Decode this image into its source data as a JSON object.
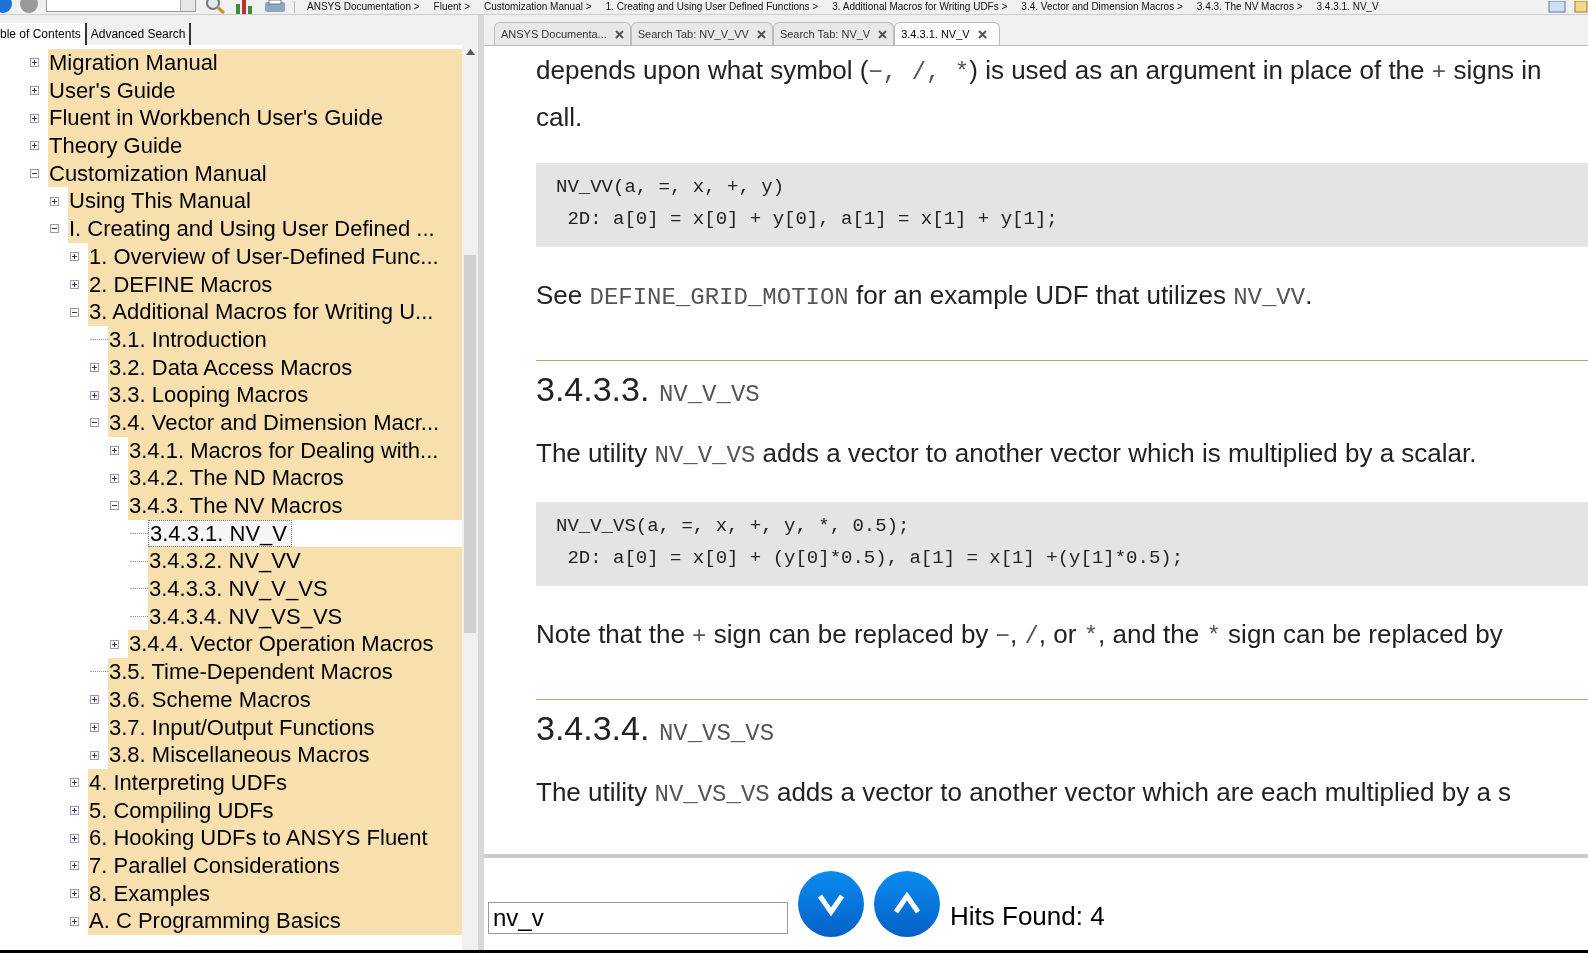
{
  "toolbar": {
    "breadcrumb": [
      "ANSYS Documentation >",
      "Fluent >",
      "Customization Manual >",
      "1. Creating and Using User Defined Functions >",
      "3. Additional Macros for Writing UDFs >",
      "3.4. Vector and Dimension Macros >",
      "3.4.3. The NV Macros >",
      "3.4.3.1. NV_V"
    ]
  },
  "left_tabs": [
    {
      "label": "ble of Contents",
      "selected": true
    },
    {
      "label": "Advanced Search",
      "selected": false
    }
  ],
  "tree": [
    {
      "label": "Migration Manual",
      "expanded": false,
      "selected": false
    },
    {
      "label": "User's Guide",
      "expanded": false,
      "selected": false
    },
    {
      "label": "Fluent in Workbench User's Guide",
      "expanded": false,
      "selected": false
    },
    {
      "label": "Theory Guide",
      "expanded": false,
      "selected": false
    },
    {
      "label": "Customization Manual",
      "expanded": true,
      "selected": false,
      "children": [
        {
          "label": "Using This Manual",
          "expanded": false,
          "selected": false
        },
        {
          "label": "I. Creating and Using User Defined ...",
          "expanded": true,
          "selected": false,
          "children": [
            {
              "label": "1. Overview of User-Defined Func...",
              "expanded": false,
              "selected": false
            },
            {
              "label": "2. DEFINE Macros",
              "expanded": false,
              "selected": false
            },
            {
              "label": "3. Additional Macros for Writing U...",
              "expanded": true,
              "selected": false,
              "children": [
                {
                  "label": "3.1. Introduction",
                  "selected": false
                },
                {
                  "label": "3.2. Data Access Macros",
                  "expanded": false,
                  "selected": false
                },
                {
                  "label": "3.3. Looping Macros",
                  "expanded": false,
                  "selected": false
                },
                {
                  "label": "3.4. Vector and Dimension Macr...",
                  "expanded": true,
                  "selected": false,
                  "children": [
                    {
                      "label": "3.4.1. Macros for Dealing with...",
                      "expanded": false,
                      "selected": false
                    },
                    {
                      "label": "3.4.2. The ND Macros",
                      "expanded": false,
                      "selected": false
                    },
                    {
                      "label": "3.4.3. The NV Macros",
                      "expanded": true,
                      "selected": false,
                      "children": [
                        {
                          "label": "3.4.3.1. NV_V",
                          "selected": true
                        },
                        {
                          "label": "3.4.3.2. NV_VV",
                          "selected": false
                        },
                        {
                          "label": "3.4.3.3. NV_V_VS",
                          "selected": false
                        },
                        {
                          "label": "3.4.3.4. NV_VS_VS",
                          "selected": false
                        }
                      ]
                    },
                    {
                      "label": "3.4.4. Vector Operation Macros",
                      "expanded": false,
                      "selected": false
                    }
                  ]
                },
                {
                  "label": "3.5. Time-Dependent Macros",
                  "selected": false
                },
                {
                  "label": "3.6. Scheme Macros",
                  "expanded": false,
                  "selected": false
                },
                {
                  "label": "3.7. Input/Output Functions",
                  "expanded": false,
                  "selected": false
                },
                {
                  "label": "3.8. Miscellaneous Macros",
                  "expanded": false,
                  "selected": false
                }
              ]
            },
            {
              "label": "4. Interpreting UDFs",
              "expanded": false,
              "selected": false
            },
            {
              "label": "5. Compiling UDFs",
              "expanded": false,
              "selected": false
            },
            {
              "label": "6. Hooking UDFs to ANSYS Fluent",
              "expanded": false,
              "selected": false
            },
            {
              "label": "7. Parallel Considerations",
              "expanded": false,
              "selected": false
            },
            {
              "label": "8. Examples",
              "expanded": false,
              "selected": false
            },
            {
              "label": "A. C Programming Basics",
              "expanded": false,
              "selected": false
            }
          ]
        }
      ]
    }
  ],
  "doc_tabs": [
    {
      "label": "ANSYS Documenta...",
      "selected": false
    },
    {
      "label": "Search Tab: NV_V_VV",
      "selected": false
    },
    {
      "label": "Search Tab: NV_V",
      "selected": false
    },
    {
      "label": "3.4.3.1. NV_V",
      "selected": true
    }
  ],
  "content": [
    {
      "kind": "paragraph",
      "lines": [
        [
          {
            "text": "depends upon what symbol ("
          },
          {
            "text": "−, /, *",
            "code": true
          },
          {
            "text": ") is used as an argument in place of the "
          },
          {
            "text": "+",
            "code": true
          },
          {
            "text": " signs in"
          }
        ],
        [
          {
            "text": "call."
          }
        ]
      ]
    },
    {
      "kind": "code",
      "lines": [
        "NV_VV(a, =, x, +, y)",
        " 2D: a[0] = x[0] + y[0], a[1] = x[1] + y[1];"
      ]
    },
    {
      "kind": "paragraph",
      "lines": [
        [
          {
            "text": "See "
          },
          {
            "text": "DEFINE_GRID_MOTION",
            "code": true
          },
          {
            "text": " for an example UDF that utilizes "
          },
          {
            "text": "NV_VV",
            "code": true
          },
          {
            "text": "."
          }
        ]
      ]
    },
    {
      "kind": "heading",
      "number": "3.4.3.3.",
      "name": "NV_V_VS"
    },
    {
      "kind": "paragraph",
      "lines": [
        [
          {
            "text": "The utility "
          },
          {
            "text": "NV_V_VS",
            "code": true
          },
          {
            "text": " adds a vector to another vector which is multiplied by a scalar."
          }
        ]
      ]
    },
    {
      "kind": "code",
      "lines": [
        "NV_V_VS(a, =, x, +, y, *, 0.5);",
        " 2D: a[0] = x[0] + (y[0]*0.5), a[1] = x[1] +(y[1]*0.5);"
      ]
    },
    {
      "kind": "paragraph",
      "lines": [
        [
          {
            "text": "Note that the "
          },
          {
            "text": "+",
            "code": true
          },
          {
            "text": " sign can be replaced by "
          },
          {
            "text": "−",
            "code": true
          },
          {
            "text": ", "
          },
          {
            "text": "/",
            "code": true
          },
          {
            "text": ", or "
          },
          {
            "text": "*",
            "code": true
          },
          {
            "text": ", and the "
          },
          {
            "text": "*",
            "code": true
          },
          {
            "text": " sign can be replaced by"
          }
        ]
      ]
    },
    {
      "kind": "heading",
      "number": "3.4.3.4.",
      "name": "NV_VS_VS"
    },
    {
      "kind": "paragraph",
      "lines": [
        [
          {
            "text": "The utility "
          },
          {
            "text": "NV_VS_VS",
            "code": true
          },
          {
            "text": " adds a vector to another vector which are each multiplied by a s"
          }
        ]
      ]
    }
  ],
  "search_bar": {
    "value": "nv_v",
    "hits": "Hits Found: 4"
  }
}
